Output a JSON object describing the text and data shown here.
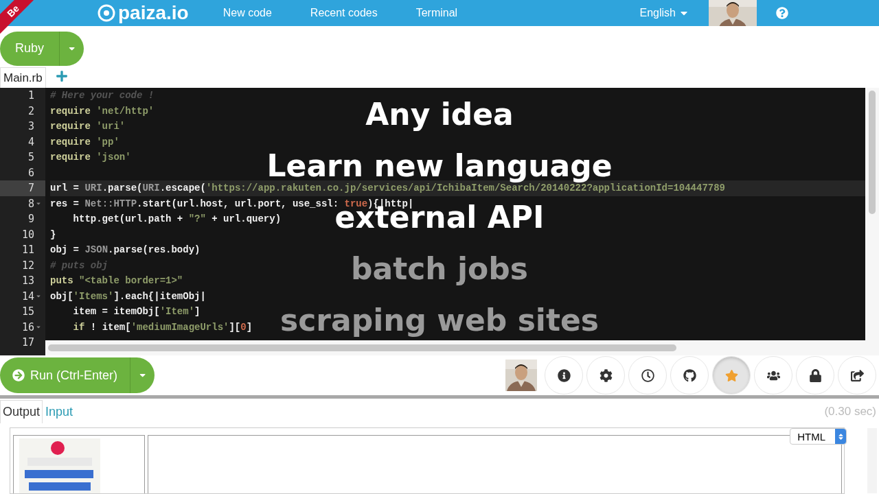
{
  "ribbon": "Be",
  "header": {
    "logo": "paiza.io",
    "nav": [
      "New code",
      "Recent codes",
      "Terminal"
    ],
    "language": "English"
  },
  "language_button": {
    "label": "Ruby"
  },
  "file_tabs": [
    {
      "label": "Main.rb",
      "selected": true
    }
  ],
  "editor": {
    "lines": [
      {
        "number": "1",
        "active": false,
        "foldable": false,
        "tokens": [
          {
            "kind": "comment",
            "text": "# Here your code !"
          }
        ]
      },
      {
        "number": "2",
        "active": false,
        "foldable": false,
        "tokens": [
          {
            "kind": "keyword",
            "text": "require "
          },
          {
            "kind": "string",
            "text": "'net/http'"
          }
        ]
      },
      {
        "number": "3",
        "active": false,
        "foldable": false,
        "tokens": [
          {
            "kind": "keyword",
            "text": "require "
          },
          {
            "kind": "string",
            "text": "'uri'"
          }
        ]
      },
      {
        "number": "4",
        "active": false,
        "foldable": false,
        "tokens": [
          {
            "kind": "keyword",
            "text": "require "
          },
          {
            "kind": "string",
            "text": "'pp'"
          }
        ]
      },
      {
        "number": "5",
        "active": false,
        "foldable": false,
        "tokens": [
          {
            "kind": "keyword",
            "text": "require "
          },
          {
            "kind": "string",
            "text": "'json'"
          }
        ]
      },
      {
        "number": "6",
        "active": false,
        "foldable": false
      },
      {
        "number": "7",
        "active": true,
        "foldable": false,
        "tokens": [
          {
            "kind": "plain",
            "text": "url = "
          },
          {
            "kind": "constant",
            "text": "URI"
          },
          {
            "kind": "plain",
            "text": ".parse("
          },
          {
            "kind": "constant",
            "text": "URI"
          },
          {
            "kind": "plain",
            "text": ".escape("
          },
          {
            "kind": "string",
            "text": "'https://app.rakuten.co.jp/services/api/IchibaItem/Search/20140222?applicationId=104447789"
          }
        ]
      },
      {
        "number": "8",
        "active": false,
        "foldable": true,
        "tokens": [
          {
            "kind": "plain",
            "text": "res = "
          },
          {
            "kind": "constant",
            "text": "Net::HTTP"
          },
          {
            "kind": "plain",
            "text": ".start(url.host, url.port, use_ssl: "
          },
          {
            "kind": "boolean",
            "text": "true"
          },
          {
            "kind": "plain",
            "text": "){|http|"
          }
        ]
      },
      {
        "number": "9",
        "active": false,
        "foldable": false,
        "tokens": [
          {
            "kind": "plain",
            "text": "    http.get(url.path + "
          },
          {
            "kind": "string",
            "text": "\"?\""
          },
          {
            "kind": "plain",
            "text": " + url.query)"
          }
        ]
      },
      {
        "number": "10",
        "active": false,
        "foldable": false,
        "tokens": [
          {
            "kind": "plain",
            "text": "}"
          }
        ]
      },
      {
        "number": "11",
        "active": false,
        "foldable": false,
        "tokens": [
          {
            "kind": "plain",
            "text": "obj = "
          },
          {
            "kind": "constant",
            "text": "JSON"
          },
          {
            "kind": "plain",
            "text": ".parse(res.body)"
          }
        ]
      },
      {
        "number": "12",
        "active": false,
        "foldable": false,
        "tokens": [
          {
            "kind": "comment",
            "text": "# puts obj"
          }
        ]
      },
      {
        "number": "13",
        "active": false,
        "foldable": false,
        "tokens": [
          {
            "kind": "keyword",
            "text": "puts "
          },
          {
            "kind": "string",
            "text": "\"<table border=1>\""
          }
        ]
      },
      {
        "number": "14",
        "active": false,
        "foldable": true,
        "tokens": [
          {
            "kind": "plain",
            "text": "obj["
          },
          {
            "kind": "string",
            "text": "'Items'"
          },
          {
            "kind": "plain",
            "text": "].each{|itemObj|"
          }
        ]
      },
      {
        "number": "15",
        "active": false,
        "foldable": false,
        "tokens": [
          {
            "kind": "plain",
            "text": "    item = itemObj["
          },
          {
            "kind": "string",
            "text": "'Item'"
          },
          {
            "kind": "plain",
            "text": "]"
          }
        ]
      },
      {
        "number": "16",
        "active": false,
        "foldable": true,
        "tokens": [
          {
            "kind": "keyword",
            "text": "    if"
          },
          {
            "kind": "plain",
            "text": " ! item["
          },
          {
            "kind": "string",
            "text": "'mediumImageUrls'"
          },
          {
            "kind": "plain",
            "text": "]["
          },
          {
            "kind": "number",
            "text": "0"
          },
          {
            "kind": "plain",
            "text": "]"
          }
        ]
      },
      {
        "number": "17",
        "active": false,
        "foldable": false
      }
    ]
  },
  "captions": [
    {
      "text": "Any idea",
      "faded": false
    },
    {
      "text": "Learn new language",
      "faded": false
    },
    {
      "text": "external API",
      "faded": false
    },
    {
      "text": "batch jobs",
      "faded": true
    },
    {
      "text": "scraping web sites",
      "faded": true
    }
  ],
  "run_button": {
    "label": "Run (Ctrl-Enter)"
  },
  "toolbar": [
    {
      "kind": "info",
      "selected": false
    },
    {
      "kind": "settings",
      "selected": false
    },
    {
      "kind": "history",
      "selected": false
    },
    {
      "kind": "github",
      "selected": false
    },
    {
      "kind": "star",
      "selected": true
    },
    {
      "kind": "users",
      "selected": false
    },
    {
      "kind": "lock",
      "selected": false
    },
    {
      "kind": "share",
      "selected": false
    }
  ],
  "output": {
    "tabs": [
      {
        "label": "Output",
        "selected": true
      },
      {
        "label": "Input",
        "selected": false
      }
    ],
    "elapsed": "(0.30 sec)",
    "format": "HTML"
  }
}
